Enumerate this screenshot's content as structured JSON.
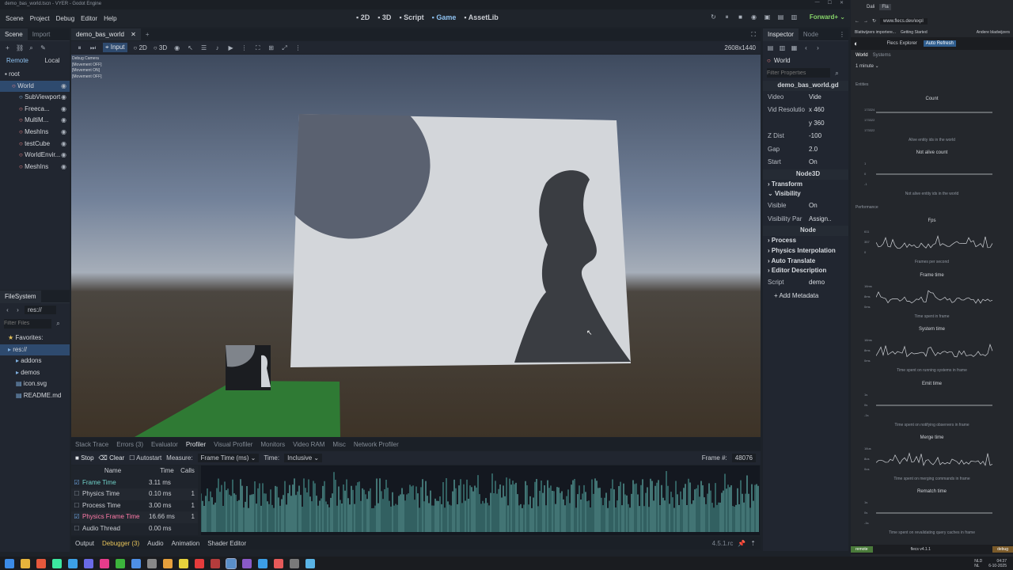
{
  "window": {
    "title": "demo_bas_world.tscn - VYER - Godot Engine"
  },
  "menu": [
    "Scene",
    "Project",
    "Debug",
    "Editor",
    "Help"
  ],
  "workspaces": [
    {
      "label": "2D",
      "icon": "2d-icon"
    },
    {
      "label": "3D",
      "icon": "3d-icon"
    },
    {
      "label": "Script",
      "icon": "script-icon"
    },
    {
      "label": "Game",
      "icon": "game-icon",
      "active": true
    },
    {
      "label": "AssetLib",
      "icon": "assetlib-icon"
    }
  ],
  "renderer": "Forward+",
  "scene_dock": {
    "tabs": [
      "Scene",
      "Import"
    ],
    "subtabs": [
      "Remote",
      "Local"
    ],
    "tree": [
      {
        "label": "root",
        "indent": 0
      },
      {
        "label": "World",
        "indent": 1,
        "sel": true
      },
      {
        "label": "SubViewport",
        "indent": 2
      },
      {
        "label": "Freeca...",
        "indent": 2
      },
      {
        "label": "MultiM...",
        "indent": 2
      },
      {
        "label": "MeshIns",
        "indent": 2
      },
      {
        "label": "testCube",
        "indent": 2
      },
      {
        "label": "WorldEnvir...",
        "indent": 2
      },
      {
        "label": "MeshIns",
        "indent": 2
      }
    ]
  },
  "filesystem": {
    "title": "FileSystem",
    "path": "res://",
    "filter_placeholder": "Filter Files",
    "items": [
      {
        "label": "Favorites:",
        "indent": 0
      },
      {
        "label": "res://",
        "indent": 0,
        "sel": true
      },
      {
        "label": "addons",
        "indent": 1
      },
      {
        "label": "demos",
        "indent": 1
      },
      {
        "label": "icon.svg",
        "indent": 1
      },
      {
        "label": "README.md",
        "indent": 1
      }
    ]
  },
  "editor_tab": "demo_bas_world",
  "game_toolbar": {
    "input_label": "Input",
    "d2": "2D",
    "d3": "3D",
    "resolution": "2608x1440"
  },
  "debug_overlay": [
    "Debug Camera",
    "[Movement OFF]",
    "[Movement ON]",
    "[Movement OFF]"
  ],
  "inspector": {
    "tabs": [
      "Inspector",
      "Node"
    ],
    "object": "World",
    "filter_placeholder": "Filter Properties",
    "script_file": "demo_bas_world.gd",
    "props": [
      {
        "k": "Video",
        "v": "Vide"
      },
      {
        "k": "Vid Resolutio",
        "v": "x 460"
      },
      {
        "k": "",
        "v": "y 360"
      },
      {
        "k": "Z Dist",
        "v": "-100"
      },
      {
        "k": "Gap",
        "v": "2.0"
      },
      {
        "k": "Start",
        "v": "On"
      }
    ],
    "section_node3d": "Node3D",
    "transform": "Transform",
    "visibility": "Visibility",
    "visible_label": "Visible",
    "visible_val": "On",
    "visparent_label": "Visibility Par",
    "visparent_val": "Assign..",
    "section_node": "Node",
    "node_sections": [
      "Process",
      "Physics Interpolation",
      "Auto Translate",
      "Editor Description"
    ],
    "script_label": "Script",
    "script_val": "demo",
    "add_metadata": "Add Metadata"
  },
  "bottom": {
    "tabs": [
      "Stack Trace",
      "Errors (3)",
      "Evaluator",
      "Profiler",
      "Visual Profiler",
      "Monitors",
      "Video RAM",
      "Misc",
      "Network Profiler"
    ],
    "stop": "Stop",
    "clear": "Clear",
    "autostart": "Autostart",
    "measure_label": "Measure:",
    "measure_val": "Frame Time (ms)",
    "time_label": "Time:",
    "time_val": "Inclusive",
    "frame_label": "Frame #:",
    "frame_val": "48076",
    "cols": [
      "Name",
      "Time",
      "Calls"
    ],
    "rows": [
      {
        "name": "Frame Time",
        "time": "3.11 ms",
        "calls": "",
        "color": "#6fd0c8"
      },
      {
        "name": "Physics Time",
        "time": "0.10 ms",
        "calls": "1",
        "color": ""
      },
      {
        "name": "Process Time",
        "time": "3.00 ms",
        "calls": "1",
        "color": ""
      },
      {
        "name": "Physics Frame Time",
        "time": "16.66 ms",
        "calls": "1",
        "color": "#ff7aa8"
      },
      {
        "name": "Audio Thread",
        "time": "0.00 ms",
        "calls": "",
        "color": ""
      }
    ],
    "panels": [
      "Output",
      "Debugger (3)",
      "Audio",
      "Animation",
      "Shader Editor"
    ],
    "version": "4.5.1.rc"
  },
  "browser": {
    "tabs": [
      "Dali",
      "Fla"
    ],
    "url": "www.flecs.dev/expl",
    "bookmarks": [
      "Blattwijzers importere...",
      "Getting Started",
      "Andere bladwijzers"
    ],
    "app_title": "Flecs Explorer",
    "auto_refresh": "Auto Refresh",
    "tabs2": [
      "World",
      "Systems"
    ],
    "range": "1 minute",
    "entities": "Entities",
    "count_title": "Count",
    "count_vals": [
      "173324",
      "173322",
      "173322"
    ],
    "count_sub": "Alive entity ids in the world",
    "notalive_title": "Not alive count",
    "notalive_vals": [
      "1",
      "0",
      "-1"
    ],
    "notalive_sub": "Not alive entity ids in the world",
    "performance": "Performance",
    "fps_title": "Fps",
    "fps_vals": [
      "611",
      "357",
      "0"
    ],
    "fps_sub": "Frames per second",
    "ft_title": "Frame time",
    "ft_vals": [
      "16ms",
      "8ms",
      "0ms"
    ],
    "ft_sub": "Time spent in frame",
    "st_title": "System time",
    "st_vals": [
      "16ms",
      "8ms",
      "0ms"
    ],
    "st_sub": "Time spent on running systems in frame",
    "et_title": "Emit time",
    "et_vals": [
      "1s",
      "0s",
      "-1s"
    ],
    "et_sub": "Time spent on notifying observers in frame",
    "mt_title": "Merge time",
    "mt_vals": [
      "16us",
      "8us",
      "0us"
    ],
    "mt_sub": "Time spent on merging commands in frame",
    "rt_title": "Rematch time",
    "rt_vals": [
      "1s",
      "0s",
      "-1s"
    ],
    "rt_sub": "Time spent on revalidating query caches in frame",
    "status_left": "remote",
    "status_mid": "flecs v4.1.1",
    "status_right": "debug"
  },
  "taskbar": {
    "lang": "NLD\nNL",
    "time": "04:37",
    "date": "6-10-2025"
  }
}
